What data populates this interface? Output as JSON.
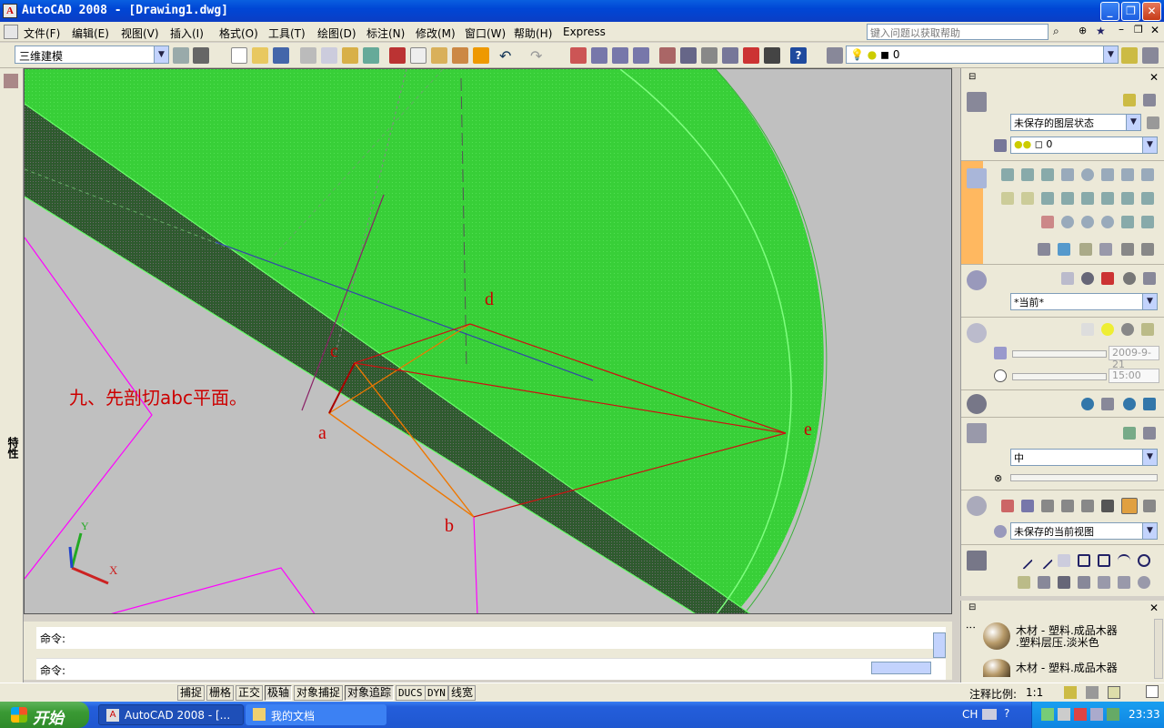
{
  "window": {
    "title": "AutoCAD 2008 - [Drawing1.dwg]",
    "app_icon": "autocad-icon",
    "controls": [
      "minimize",
      "restore",
      "close"
    ]
  },
  "menu": {
    "items": [
      "文件(F)",
      "编辑(E)",
      "视图(V)",
      "插入(I)",
      "格式(O)",
      "工具(T)",
      "绘图(D)",
      "标注(N)",
      "修改(M)",
      "窗口(W)",
      "帮助(H)",
      "Express"
    ],
    "help_placeholder": "键入问题以获取帮助"
  },
  "toolbar": {
    "workspace": "三维建模",
    "layer_value": "0"
  },
  "left_strip": {
    "label": "特性"
  },
  "drawing": {
    "annotation": "九、先剖切abc平面。",
    "points": [
      "a",
      "b",
      "c",
      "d",
      "e"
    ],
    "ucs": {
      "y": "Y",
      "x": "X"
    },
    "colors": {
      "solid": "#33cc33",
      "section": "#444444",
      "lines_red": "#cc1111",
      "lines_orange": "#ee7700",
      "magenta": "#ff00ff",
      "label": "#cc0000"
    }
  },
  "right_panel": {
    "layer_state": "未保存的图层状态",
    "layer_value": "0",
    "visual_style": "*当前*",
    "date": "2009-9-21",
    "time": "15:00",
    "material_value": "中",
    "view": "未保存的当前视图"
  },
  "materials": {
    "item1_line1": "木材 - 塑料.成品木器",
    "item1_line2": ".塑料层压.淡米色",
    "item2_line1": "木材 - 塑料.成品木器"
  },
  "command": {
    "line1": "命令:",
    "line2": "命令:"
  },
  "status": {
    "buttons": [
      "捕捉",
      "栅格",
      "正交",
      "极轴",
      "对象捕捉",
      "对象追踪",
      "DUCS",
      "DYN",
      "线宽"
    ],
    "on": [
      false,
      false,
      false,
      true,
      false,
      true,
      false,
      false,
      false
    ],
    "annotation_scale_label": "注释比例:",
    "annotation_scale_value": "1:1"
  },
  "taskbar": {
    "start": "开始",
    "tasks": [
      "AutoCAD 2008 - [...",
      "我的文档"
    ],
    "tray_lang": "CH",
    "clock": "23:33"
  }
}
